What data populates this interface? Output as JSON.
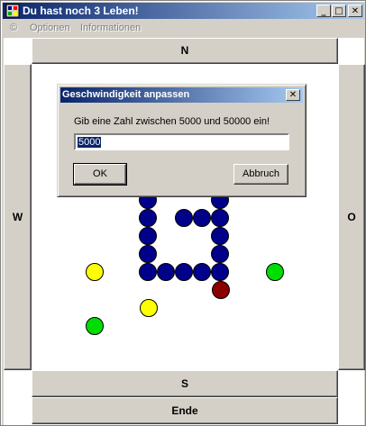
{
  "window": {
    "title": "Du hast noch 3 Leben!",
    "controls": {
      "minimize": "_",
      "maximize": "□",
      "close": "✕"
    }
  },
  "menu": {
    "items": [
      {
        "label": "©"
      },
      {
        "label": "Optionen"
      },
      {
        "label": "Informationen"
      }
    ]
  },
  "game": {
    "directions": {
      "north": "N",
      "west": "W",
      "east": "O",
      "south": "S"
    },
    "end_label": "Ende",
    "colors": {
      "snake": "#00008b",
      "yellow": "#ffff00",
      "green": "#00dd00",
      "red": "#8b0000"
    }
  },
  "dialog": {
    "title": "Geschwindigkeit anpassen",
    "close_label": "✕",
    "prompt": "Gib eine Zahl zwischen 5000 und 50000 ein!",
    "input_value": "5000",
    "ok_label": "OK",
    "cancel_label": "Abbruch"
  }
}
